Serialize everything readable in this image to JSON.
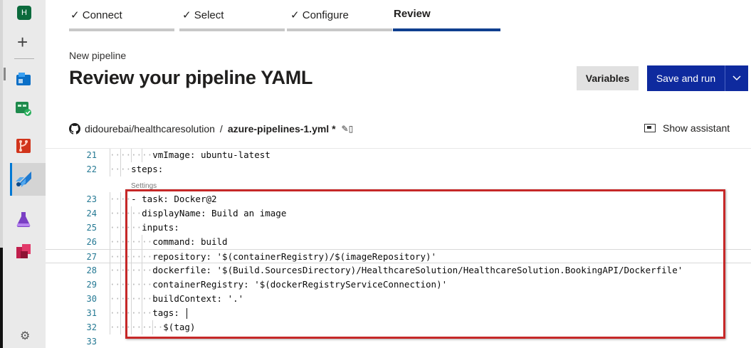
{
  "rail": {
    "org_initial": "H",
    "items": [
      "new-project",
      "boards",
      "pipelines-check",
      "repos",
      "pipelines",
      "test-plans",
      "artifacts",
      "settings"
    ]
  },
  "steps": [
    {
      "label": "Connect",
      "done": true
    },
    {
      "label": "Select",
      "done": true
    },
    {
      "label": "Configure",
      "done": true
    },
    {
      "label": "Review",
      "done": false,
      "active": true
    }
  ],
  "header": {
    "subtitle": "New pipeline",
    "title": "Review your pipeline YAML",
    "variables_label": "Variables",
    "save_run_label": "Save and run"
  },
  "path": {
    "repo": "didourebai/healthcaresolution",
    "separator": "/",
    "file": "azure-pipelines-1.yml *",
    "assistant_label": "Show assistant"
  },
  "editor": {
    "codelens": "Settings",
    "lines": [
      {
        "num": "21",
        "text": "vmImage: ubuntu-latest"
      },
      {
        "num": "22",
        "text": "steps:"
      },
      {
        "num": "23",
        "text": "- task: Docker@2"
      },
      {
        "num": "24",
        "text": "displayName: Build an image"
      },
      {
        "num": "25",
        "text": "inputs:"
      },
      {
        "num": "26",
        "text": "command: build"
      },
      {
        "num": "27",
        "text": "repository: '$(containerRegistry)/$(imageRepository)'"
      },
      {
        "num": "28",
        "text": "dockerfile: '$(Build.SourcesDirectory)/HealthcareSolution/HealthcareSolution.BookingAPI/Dockerfile'"
      },
      {
        "num": "29",
        "text": "containerRegistry: '$(dockerRegistryServiceConnection)'"
      },
      {
        "num": "30",
        "text": "buildContext: '.'"
      },
      {
        "num": "31",
        "text": "tags: "
      },
      {
        "num": "32",
        "text": "$(tag)"
      },
      {
        "num": "33",
        "text": ""
      }
    ]
  },
  "colors": {
    "primary_button": "#0e2a9e",
    "active_step": "#0f3f8f",
    "annotation": "#c62828"
  }
}
